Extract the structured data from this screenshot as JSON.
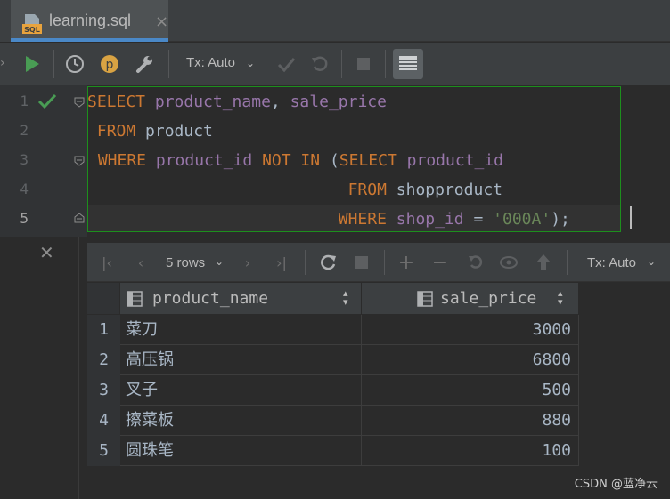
{
  "tab": {
    "title": "learning.sql",
    "icon": "sql-file-icon",
    "close": "×"
  },
  "toolbar": {
    "tx_mode": "Tx: Auto"
  },
  "editor": {
    "line_numbers": [
      "1",
      "2",
      "3",
      "4",
      "5"
    ],
    "lines": [
      [
        {
          "t": "SELECT ",
          "c": "kw"
        },
        {
          "t": "product_name",
          "c": "id"
        },
        {
          "t": ", ",
          "c": "tx"
        },
        {
          "t": "sale_price",
          "c": "id"
        }
      ],
      [
        {
          "t": " FROM ",
          "c": "kw"
        },
        {
          "t": "product",
          "c": "tx"
        }
      ],
      [
        {
          "t": " WHERE ",
          "c": "kw"
        },
        {
          "t": "product_id ",
          "c": "id"
        },
        {
          "t": "NOT IN ",
          "c": "kw"
        },
        {
          "t": "(",
          "c": "tx"
        },
        {
          "t": "SELECT ",
          "c": "kw"
        },
        {
          "t": "product_id",
          "c": "id"
        }
      ],
      [
        {
          "t": "                           FROM ",
          "c": "kw"
        },
        {
          "t": "shopproduct",
          "c": "tx"
        }
      ],
      [
        {
          "t": "                          WHERE ",
          "c": "kw"
        },
        {
          "t": "shop_id ",
          "c": "id"
        },
        {
          "t": "= ",
          "c": "tx"
        },
        {
          "t": "'000A'",
          "c": "st"
        },
        {
          "t": ");",
          "c": "tx"
        }
      ]
    ]
  },
  "results": {
    "rows_label": "5 rows",
    "tx_mode": "Tx: Auto",
    "columns": [
      "product_name",
      "sale_price"
    ],
    "rows": [
      {
        "no": "1",
        "product_name": "菜刀",
        "sale_price": "3000"
      },
      {
        "no": "2",
        "product_name": "高压锅",
        "sale_price": "6800"
      },
      {
        "no": "3",
        "product_name": "叉子",
        "sale_price": "500"
      },
      {
        "no": "4",
        "product_name": "擦菜板",
        "sale_price": "880"
      },
      {
        "no": "5",
        "product_name": "圆珠笔",
        "sale_price": "100"
      }
    ]
  },
  "watermark": "CSDN @蓝净云",
  "colors": {
    "keyword": "#cc7832",
    "identifier": "#9876aa",
    "string": "#6a8759",
    "run": "#499c54",
    "accent": "#4a88c7",
    "selection_border": "#1d8f1d"
  }
}
